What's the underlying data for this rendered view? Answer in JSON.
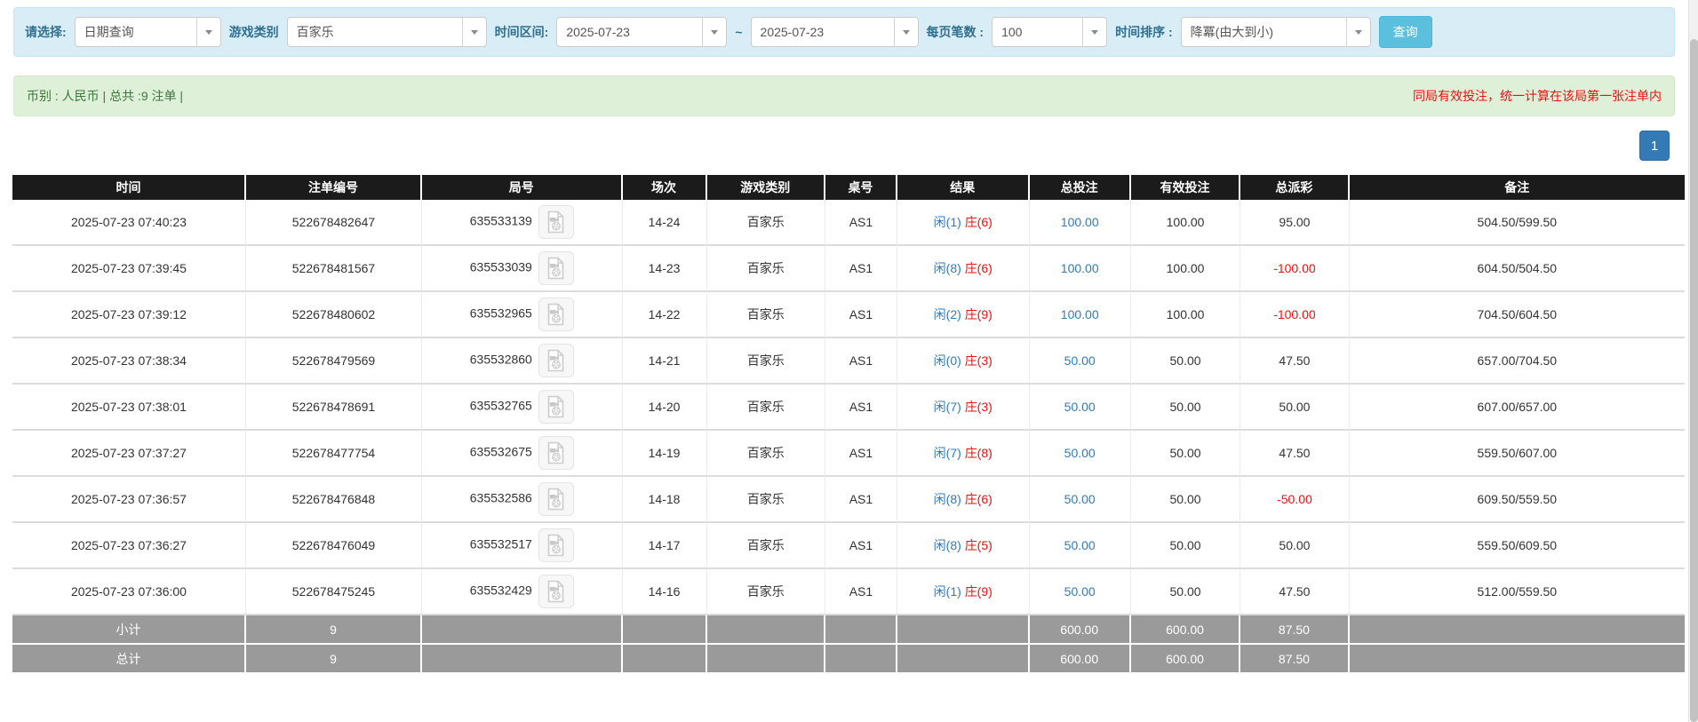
{
  "colors": {
    "filter_bg": "#d9edf7",
    "summary_bg": "#dff0d8",
    "header_bg": "#1b1b1b",
    "accent_blue": "#337ab7",
    "button_blue": "#5bc0de",
    "red": "#ee1111",
    "subtotal_gray": "#9a9a9a"
  },
  "filter_bar": {
    "select_label": "请选择:",
    "select_value": "日期查询",
    "game_label": "游戏类别",
    "game_value": "百家乐",
    "range_label": "时间区间:",
    "date_from": "2025-07-23",
    "range_separator": "~",
    "date_to": "2025-07-23",
    "page_size_label": "每页笔数 :",
    "page_size_value": "100",
    "sort_label": "时间排序 :",
    "sort_value": "降冪(由大到小)",
    "search_button": "查询"
  },
  "summary_bar": {
    "info": "币别 : 人民币 | 总共 :9 注单 |",
    "notice": "同局有效投注，统一计算在该局第一张注单内"
  },
  "pagination": {
    "current_page": "1"
  },
  "table": {
    "headers": [
      "时间",
      "注单编号",
      "局号",
      "场次",
      "游戏类别",
      "桌号",
      "结果",
      "总投注",
      "有效投注",
      "总派彩",
      "备注"
    ],
    "rows": [
      {
        "time": "2025-07-23 07:40:23",
        "bet_id": "522678482647",
        "round_id": "635533139",
        "session": "14-24",
        "game": "百家乐",
        "table_no": "AS1",
        "result_player": "闲(1)",
        "result_banker": "庄(6)",
        "total_bet": "100.00",
        "valid_bet": "100.00",
        "payout": "95.00",
        "remark": "504.50/599.50"
      },
      {
        "time": "2025-07-23 07:39:45",
        "bet_id": "522678481567",
        "round_id": "635533039",
        "session": "14-23",
        "game": "百家乐",
        "table_no": "AS1",
        "result_player": "闲(8)",
        "result_banker": "庄(6)",
        "total_bet": "100.00",
        "valid_bet": "100.00",
        "payout": "-100.00",
        "remark": "604.50/504.50"
      },
      {
        "time": "2025-07-23 07:39:12",
        "bet_id": "522678480602",
        "round_id": "635532965",
        "session": "14-22",
        "game": "百家乐",
        "table_no": "AS1",
        "result_player": "闲(2)",
        "result_banker": "庄(9)",
        "total_bet": "100.00",
        "valid_bet": "100.00",
        "payout": "-100.00",
        "remark": "704.50/604.50"
      },
      {
        "time": "2025-07-23 07:38:34",
        "bet_id": "522678479569",
        "round_id": "635532860",
        "session": "14-21",
        "game": "百家乐",
        "table_no": "AS1",
        "result_player": "闲(0)",
        "result_banker": "庄(3)",
        "total_bet": "50.00",
        "valid_bet": "50.00",
        "payout": "47.50",
        "remark": "657.00/704.50"
      },
      {
        "time": "2025-07-23 07:38:01",
        "bet_id": "522678478691",
        "round_id": "635532765",
        "session": "14-20",
        "game": "百家乐",
        "table_no": "AS1",
        "result_player": "闲(7)",
        "result_banker": "庄(3)",
        "total_bet": "50.00",
        "valid_bet": "50.00",
        "payout": "50.00",
        "remark": "607.00/657.00"
      },
      {
        "time": "2025-07-23 07:37:27",
        "bet_id": "522678477754",
        "round_id": "635532675",
        "session": "14-19",
        "game": "百家乐",
        "table_no": "AS1",
        "result_player": "闲(7)",
        "result_banker": "庄(8)",
        "total_bet": "50.00",
        "valid_bet": "50.00",
        "payout": "47.50",
        "remark": "559.50/607.00"
      },
      {
        "time": "2025-07-23 07:36:57",
        "bet_id": "522678476848",
        "round_id": "635532586",
        "session": "14-18",
        "game": "百家乐",
        "table_no": "AS1",
        "result_player": "闲(8)",
        "result_banker": "庄(6)",
        "total_bet": "50.00",
        "valid_bet": "50.00",
        "payout": "-50.00",
        "remark": "609.50/559.50"
      },
      {
        "time": "2025-07-23 07:36:27",
        "bet_id": "522678476049",
        "round_id": "635532517",
        "session": "14-17",
        "game": "百家乐",
        "table_no": "AS1",
        "result_player": "闲(8)",
        "result_banker": "庄(5)",
        "total_bet": "50.00",
        "valid_bet": "50.00",
        "payout": "50.00",
        "remark": "559.50/609.50"
      },
      {
        "time": "2025-07-23 07:36:00",
        "bet_id": "522678475245",
        "round_id": "635532429",
        "session": "14-16",
        "game": "百家乐",
        "table_no": "AS1",
        "result_player": "闲(1)",
        "result_banker": "庄(9)",
        "total_bet": "50.00",
        "valid_bet": "50.00",
        "payout": "47.50",
        "remark": "512.00/559.50"
      }
    ],
    "subtotal_row": {
      "label": "小计",
      "count": "9",
      "total_bet": "600.00",
      "valid_bet": "600.00",
      "payout": "87.50"
    },
    "total_row": {
      "label": "总计",
      "count": "9",
      "total_bet": "600.00",
      "valid_bet": "600.00",
      "payout": "87.50"
    }
  }
}
